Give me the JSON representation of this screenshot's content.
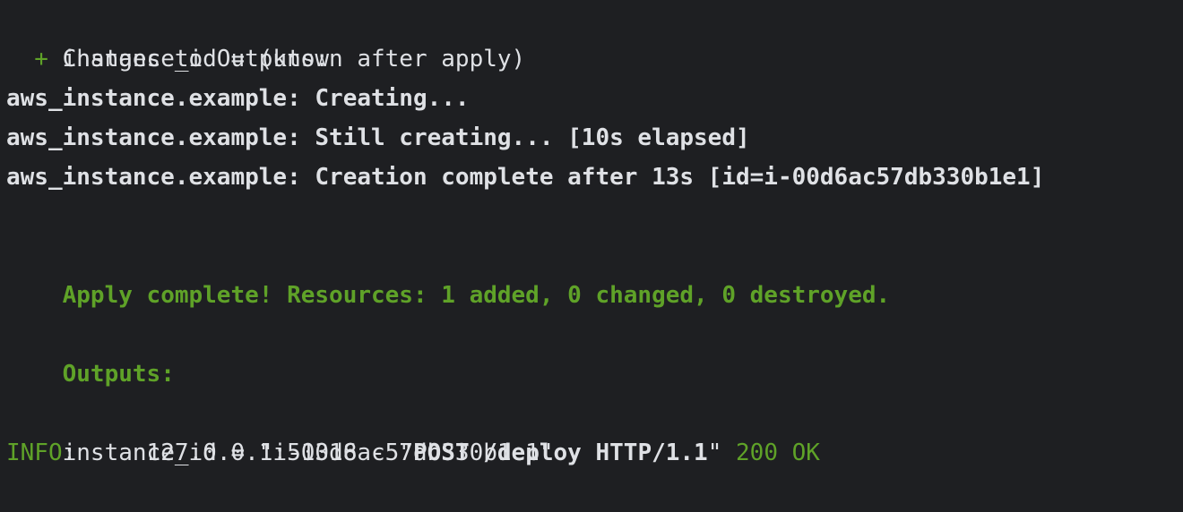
{
  "colors": {
    "background": "#1e1f22",
    "text": "#dfe1e5",
    "success_green": "#5fa228"
  },
  "lines": {
    "changes_header": "Changes to Outputs:",
    "plus_marker": "  + ",
    "plan_output": "instance_id = (known after apply)",
    "resource": "aws_instance.example:",
    "creating": " Creating...",
    "still_creating": " Still creating... [10s elapsed]",
    "creation_complete": " Creation complete after 13s [id=i-00d6ac57db330b1e1]",
    "apply_complete": "Apply complete! Resources: 1 added, 0 changed, 0 destroyed.",
    "outputs_header": "Outputs:",
    "output_value": "instance_id = \"i-00d6ac57db330b1e1\"",
    "info_level": "INFO",
    "info_sep": ":     ",
    "info_client": "127.0.0.1:51318",
    "info_dash": " - ",
    "info_quote_open": "\"",
    "info_request": "POST /deploy HTTP/1.1",
    "info_quote_close": "\"",
    "info_status": " 200 OK"
  }
}
